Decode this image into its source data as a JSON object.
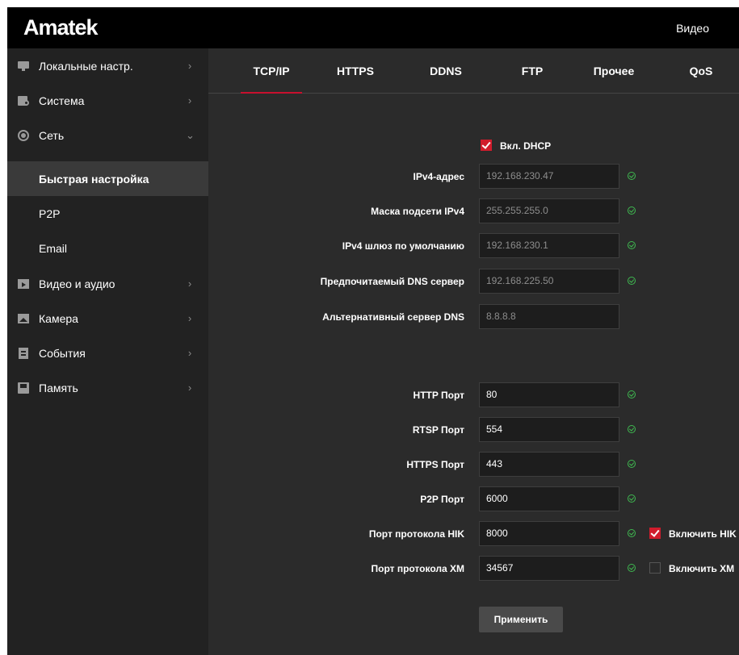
{
  "header": {
    "logo": "Amatek",
    "nav_video": "Видео"
  },
  "sidebar": {
    "items": [
      {
        "label": "Локальные настр.",
        "icon": "monitor-icon",
        "chevron": "›"
      },
      {
        "label": "Система",
        "icon": "system-icon",
        "chevron": "›"
      },
      {
        "label": "Сеть",
        "icon": "network-icon",
        "chevron": "⌄",
        "expanded": true
      },
      {
        "label": "Видео и аудио",
        "icon": "video-icon",
        "chevron": "›"
      },
      {
        "label": "Камера",
        "icon": "camera-icon",
        "chevron": "›"
      },
      {
        "label": "События",
        "icon": "events-icon",
        "chevron": "›"
      },
      {
        "label": "Память",
        "icon": "storage-icon",
        "chevron": "›"
      }
    ],
    "subitems": [
      {
        "label": "Быстрая настройка",
        "active": true
      },
      {
        "label": "P2P"
      },
      {
        "label": "Email"
      }
    ]
  },
  "tabs": [
    {
      "label": "TCP/IP",
      "active": true
    },
    {
      "label": "HTTPS"
    },
    {
      "label": "DDNS"
    },
    {
      "label": "FTP"
    },
    {
      "label": "Прочее"
    },
    {
      "label": "QoS"
    }
  ],
  "form": {
    "dhcp": {
      "label": "Вкл. DHCP",
      "checked": true
    },
    "ipv4_address": {
      "label": "IPv4-адрес",
      "value": "192.168.230.47"
    },
    "subnet_mask": {
      "label": "Маска подсети IPv4",
      "value": "255.255.255.0"
    },
    "gateway": {
      "label": "IPv4 шлюз по умолчанию",
      "value": "192.168.230.1"
    },
    "dns_primary": {
      "label": "Предпочитаемый DNS сервер",
      "value": "192.168.225.50"
    },
    "dns_alt": {
      "label": "Альтернативный сервер DNS",
      "value": "8.8.8.8"
    },
    "http_port": {
      "label": "HTTP Порт",
      "value": "80"
    },
    "rtsp_port": {
      "label": "RTSP Порт",
      "value": "554"
    },
    "https_port": {
      "label": "HTTPS Порт",
      "value": "443"
    },
    "p2p_port": {
      "label": "P2P Порт",
      "value": "6000"
    },
    "hik_port": {
      "label": "Порт протокола HIK",
      "value": "8000",
      "enable_label": "Включить HIK",
      "enabled": true
    },
    "xm_port": {
      "label": "Порт протокола XM",
      "value": "34567",
      "enable_label": "Включить XM",
      "enabled": false
    },
    "apply_label": "Применить"
  },
  "colors": {
    "accent": "#c8102e",
    "ok": "#3fb950",
    "background": "#2b2b2b",
    "sidebar": "#222222"
  }
}
